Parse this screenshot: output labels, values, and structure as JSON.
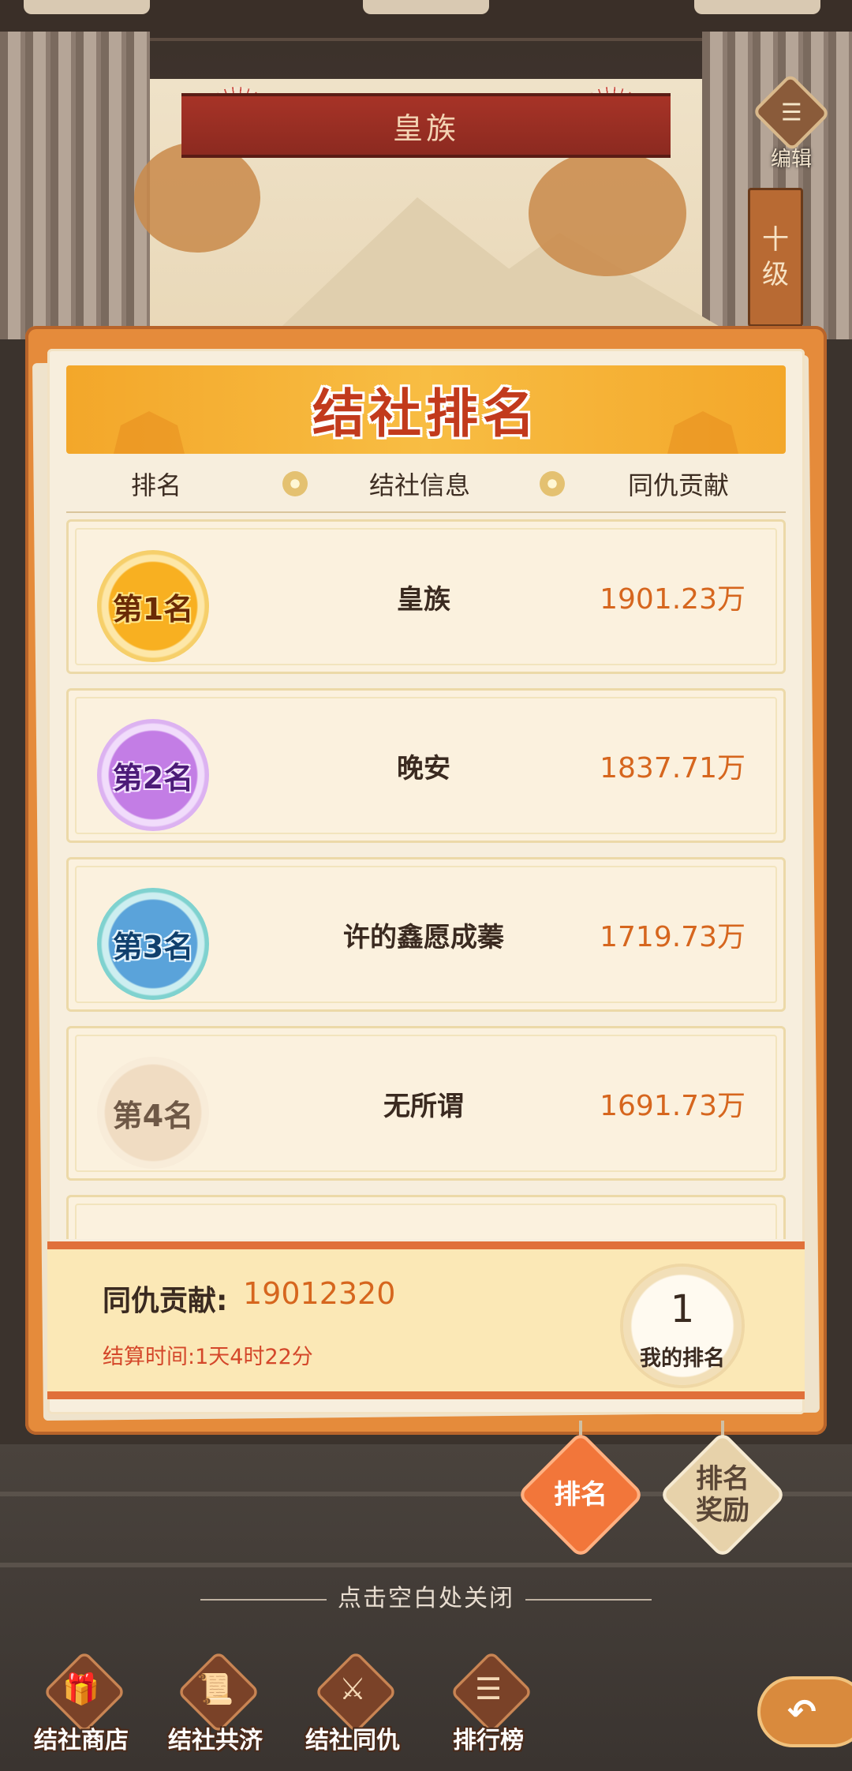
{
  "scene": {
    "guild_banner": "皇族",
    "edit_label": "编辑",
    "edit_icon": "list-icon",
    "level_tag": [
      "十",
      "级"
    ]
  },
  "panel": {
    "title": "结社排名",
    "columns": [
      "排名",
      "结社信息",
      "同仇贡献"
    ]
  },
  "rankings": [
    {
      "rank": "第1名",
      "name": "皇族",
      "score": "1901.23万"
    },
    {
      "rank": "第2名",
      "name": "晚安",
      "score": "1837.71万"
    },
    {
      "rank": "第3名",
      "name": "许的鑫愿成蓁",
      "score": "1719.73万"
    },
    {
      "rank": "第4名",
      "name": "无所谓",
      "score": "1691.73万"
    }
  ],
  "my_info": {
    "contribution_label": "同仇贡献:",
    "contribution_value": "19012320",
    "settle_time": "结算时间:1天4时22分",
    "my_rank_value": "1",
    "my_rank_label": "我的排名"
  },
  "tabs": {
    "rank": "排名",
    "reward": "排名\n奖励"
  },
  "close_hint": "点击空白处关闭",
  "bottom_nav": [
    {
      "label": "结社商店",
      "icon": "gift-icon"
    },
    {
      "label": "结社共济",
      "icon": "scroll-icon"
    },
    {
      "label": "结社同仇",
      "icon": "crossed-swords-icon"
    },
    {
      "label": "排行榜",
      "icon": "leaderboard-icon"
    }
  ],
  "back_icon": "back-arrow-icon",
  "colors": {
    "accent_orange": "#f2763a",
    "score_orange": "#d6661e",
    "panel_orange": "#e58b3b",
    "title_red": "#c23a1c"
  }
}
